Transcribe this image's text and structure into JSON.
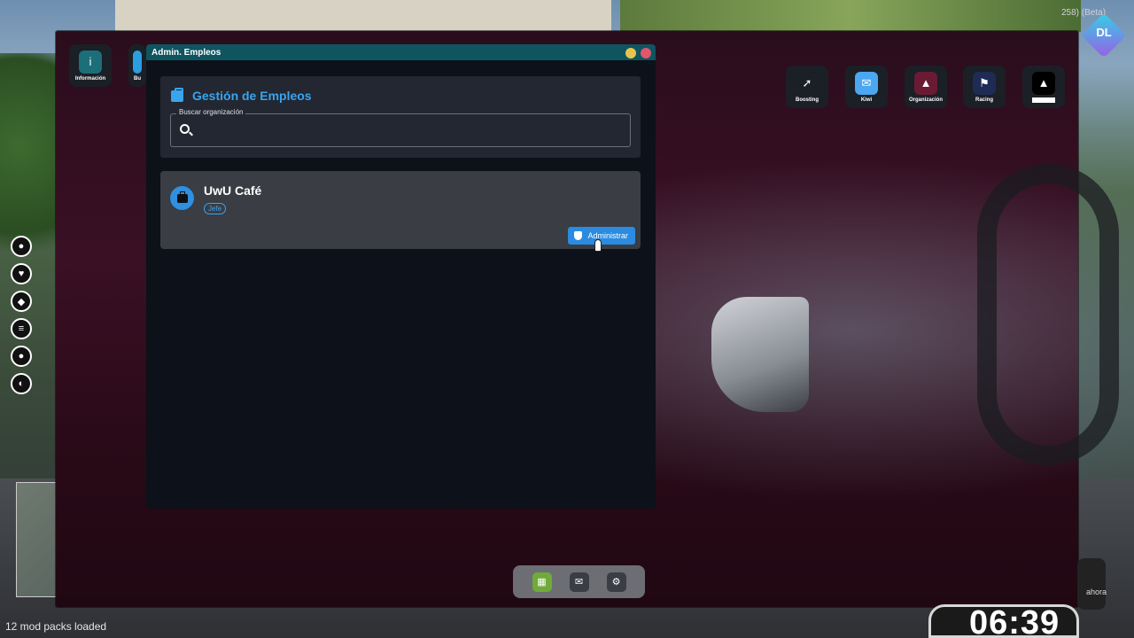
{
  "version_text": "258) (Beta)",
  "logo_text": "DL",
  "tablet_apps_left": [
    {
      "label": "Información",
      "icon": "info-icon",
      "glyph": "i",
      "color": "#1c6f78"
    },
    {
      "label": "Bu",
      "icon": "app-icon",
      "glyph": "",
      "color": "#2a9ee0"
    }
  ],
  "tablet_apps_right": [
    {
      "label": "Boosting",
      "icon": "rocket-icon",
      "glyph": "➚",
      "color": "#1b1f26"
    },
    {
      "label": "Kiwi",
      "icon": "chat-icon",
      "glyph": "✉",
      "color": "#4aa7f0"
    },
    {
      "label": "Organización",
      "icon": "building-icon",
      "glyph": "▲",
      "color": "#6b1a34"
    },
    {
      "label": "Racing",
      "icon": "flag-icon",
      "glyph": "⚑",
      "color": "#1d2b55"
    },
    {
      "label": "",
      "icon": "lock-icon",
      "glyph": "▲",
      "color": "#000000"
    }
  ],
  "window": {
    "title": "Admin. Empleos"
  },
  "search_panel": {
    "title": "Gestión de Empleos",
    "search_label": "Buscar organización",
    "search_value": ""
  },
  "organization": {
    "name": "UwU Café",
    "role": "Jefe",
    "admin_button": "Administrar"
  },
  "dock": [
    {
      "name": "jobs-icon",
      "color": "#6faa3a"
    },
    {
      "name": "mail-icon",
      "color": "#3a3d44"
    },
    {
      "name": "settings-icon",
      "color": "#3a3d44"
    }
  ],
  "status_bar": {
    "mod_packs": "12 mod packs loaded",
    "time": "06:39",
    "now_label": "ahora"
  },
  "left_stats": [
    {
      "name": "voice-icon",
      "color": "#cfcfcf"
    },
    {
      "name": "health-icon",
      "color": "#36c35b"
    },
    {
      "name": "armor-icon",
      "color": "#3d7fe0"
    },
    {
      "name": "hunger-icon",
      "color": "#e07a2a"
    },
    {
      "name": "thirst-icon",
      "color": "#3aa4ee"
    },
    {
      "name": "stress-icon",
      "color": "#e0404a"
    }
  ]
}
